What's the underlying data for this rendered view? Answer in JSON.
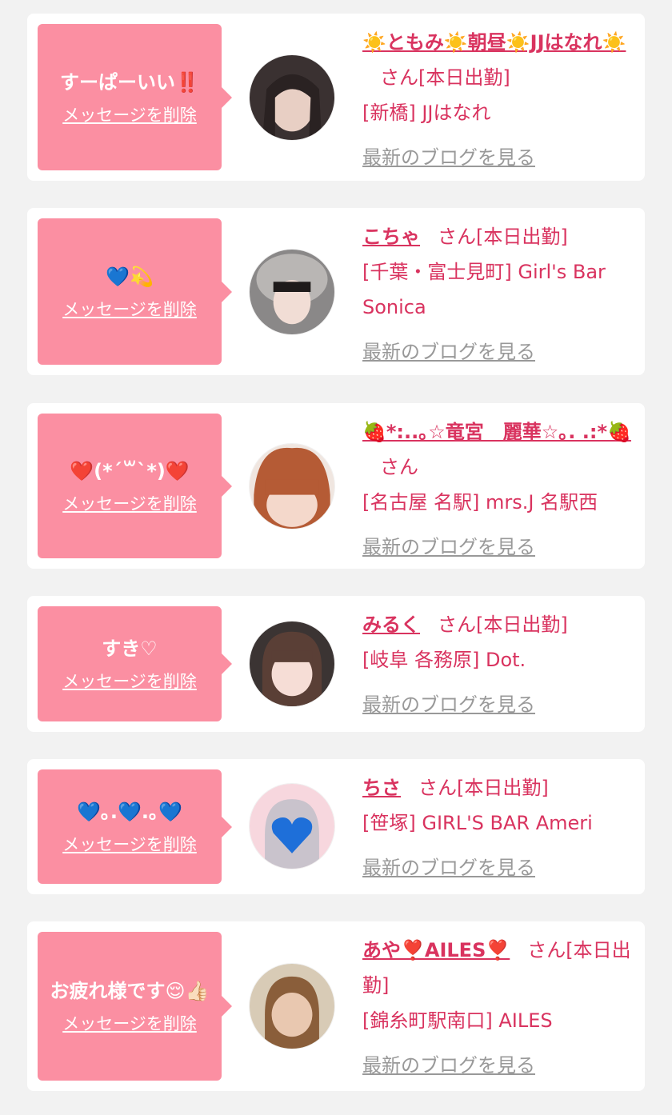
{
  "colors": {
    "accent": "#d9335f",
    "bubble": "#fb8fa2",
    "muted": "#999999",
    "background": "#f2f2f2"
  },
  "cards": [
    {
      "message": "すーぱーいい‼️",
      "delete_label": "メッセージを削除",
      "name": "☀️ともみ☀️朝昼☀️JJはなれ☀️",
      "honorific": "さん",
      "attendance": "[本日出勤]",
      "shop": "[新橋] JJはなれ",
      "blog_label": "最新のブログを見る",
      "avatar_icon": "avatar-photo"
    },
    {
      "message": "💙💫",
      "delete_label": "メッセージを削除",
      "name": "こちゃ",
      "honorific": "さん",
      "attendance": "[本日出勤]",
      "shop": "[千葉・富士見町] Girl's Bar Sonica",
      "blog_label": "最新のブログを見る",
      "avatar_icon": "avatar-photo"
    },
    {
      "message": "❤️(*´꒳`*)❤️",
      "delete_label": "メッセージを削除",
      "name": "🍓*:..｡☆竜宮　麗華☆｡. .:*🍓",
      "honorific": "さん",
      "attendance": "",
      "shop": "[名古屋 名駅] mrs.J 名駅西",
      "blog_label": "最新のブログを見る",
      "avatar_icon": "avatar-photo"
    },
    {
      "message": "すき♡",
      "delete_label": "メッセージを削除",
      "name": "みるく",
      "honorific": "さん",
      "attendance": "[本日出勤]",
      "shop": "[岐阜 各務原] Dot.",
      "blog_label": "最新のブログを見る",
      "avatar_icon": "avatar-photo"
    },
    {
      "message": "💙｡.💙.｡💙",
      "delete_label": "メッセージを削除",
      "name": "ちさ",
      "honorific": "さん",
      "attendance": "[本日出勤]",
      "shop": "[笹塚] GIRL'S BAR Ameri",
      "blog_label": "最新のブログを見る",
      "avatar_icon": "avatar-photo-heart"
    },
    {
      "message": "お疲れ様です😌👍🏻",
      "delete_label": "メッセージを削除",
      "name": "あや❣️AILES❣️",
      "honorific": "さん",
      "attendance": "[本日出勤]",
      "shop": "[錦糸町駅南口] AILES",
      "blog_label": "最新のブログを見る",
      "avatar_icon": "avatar-photo"
    }
  ]
}
